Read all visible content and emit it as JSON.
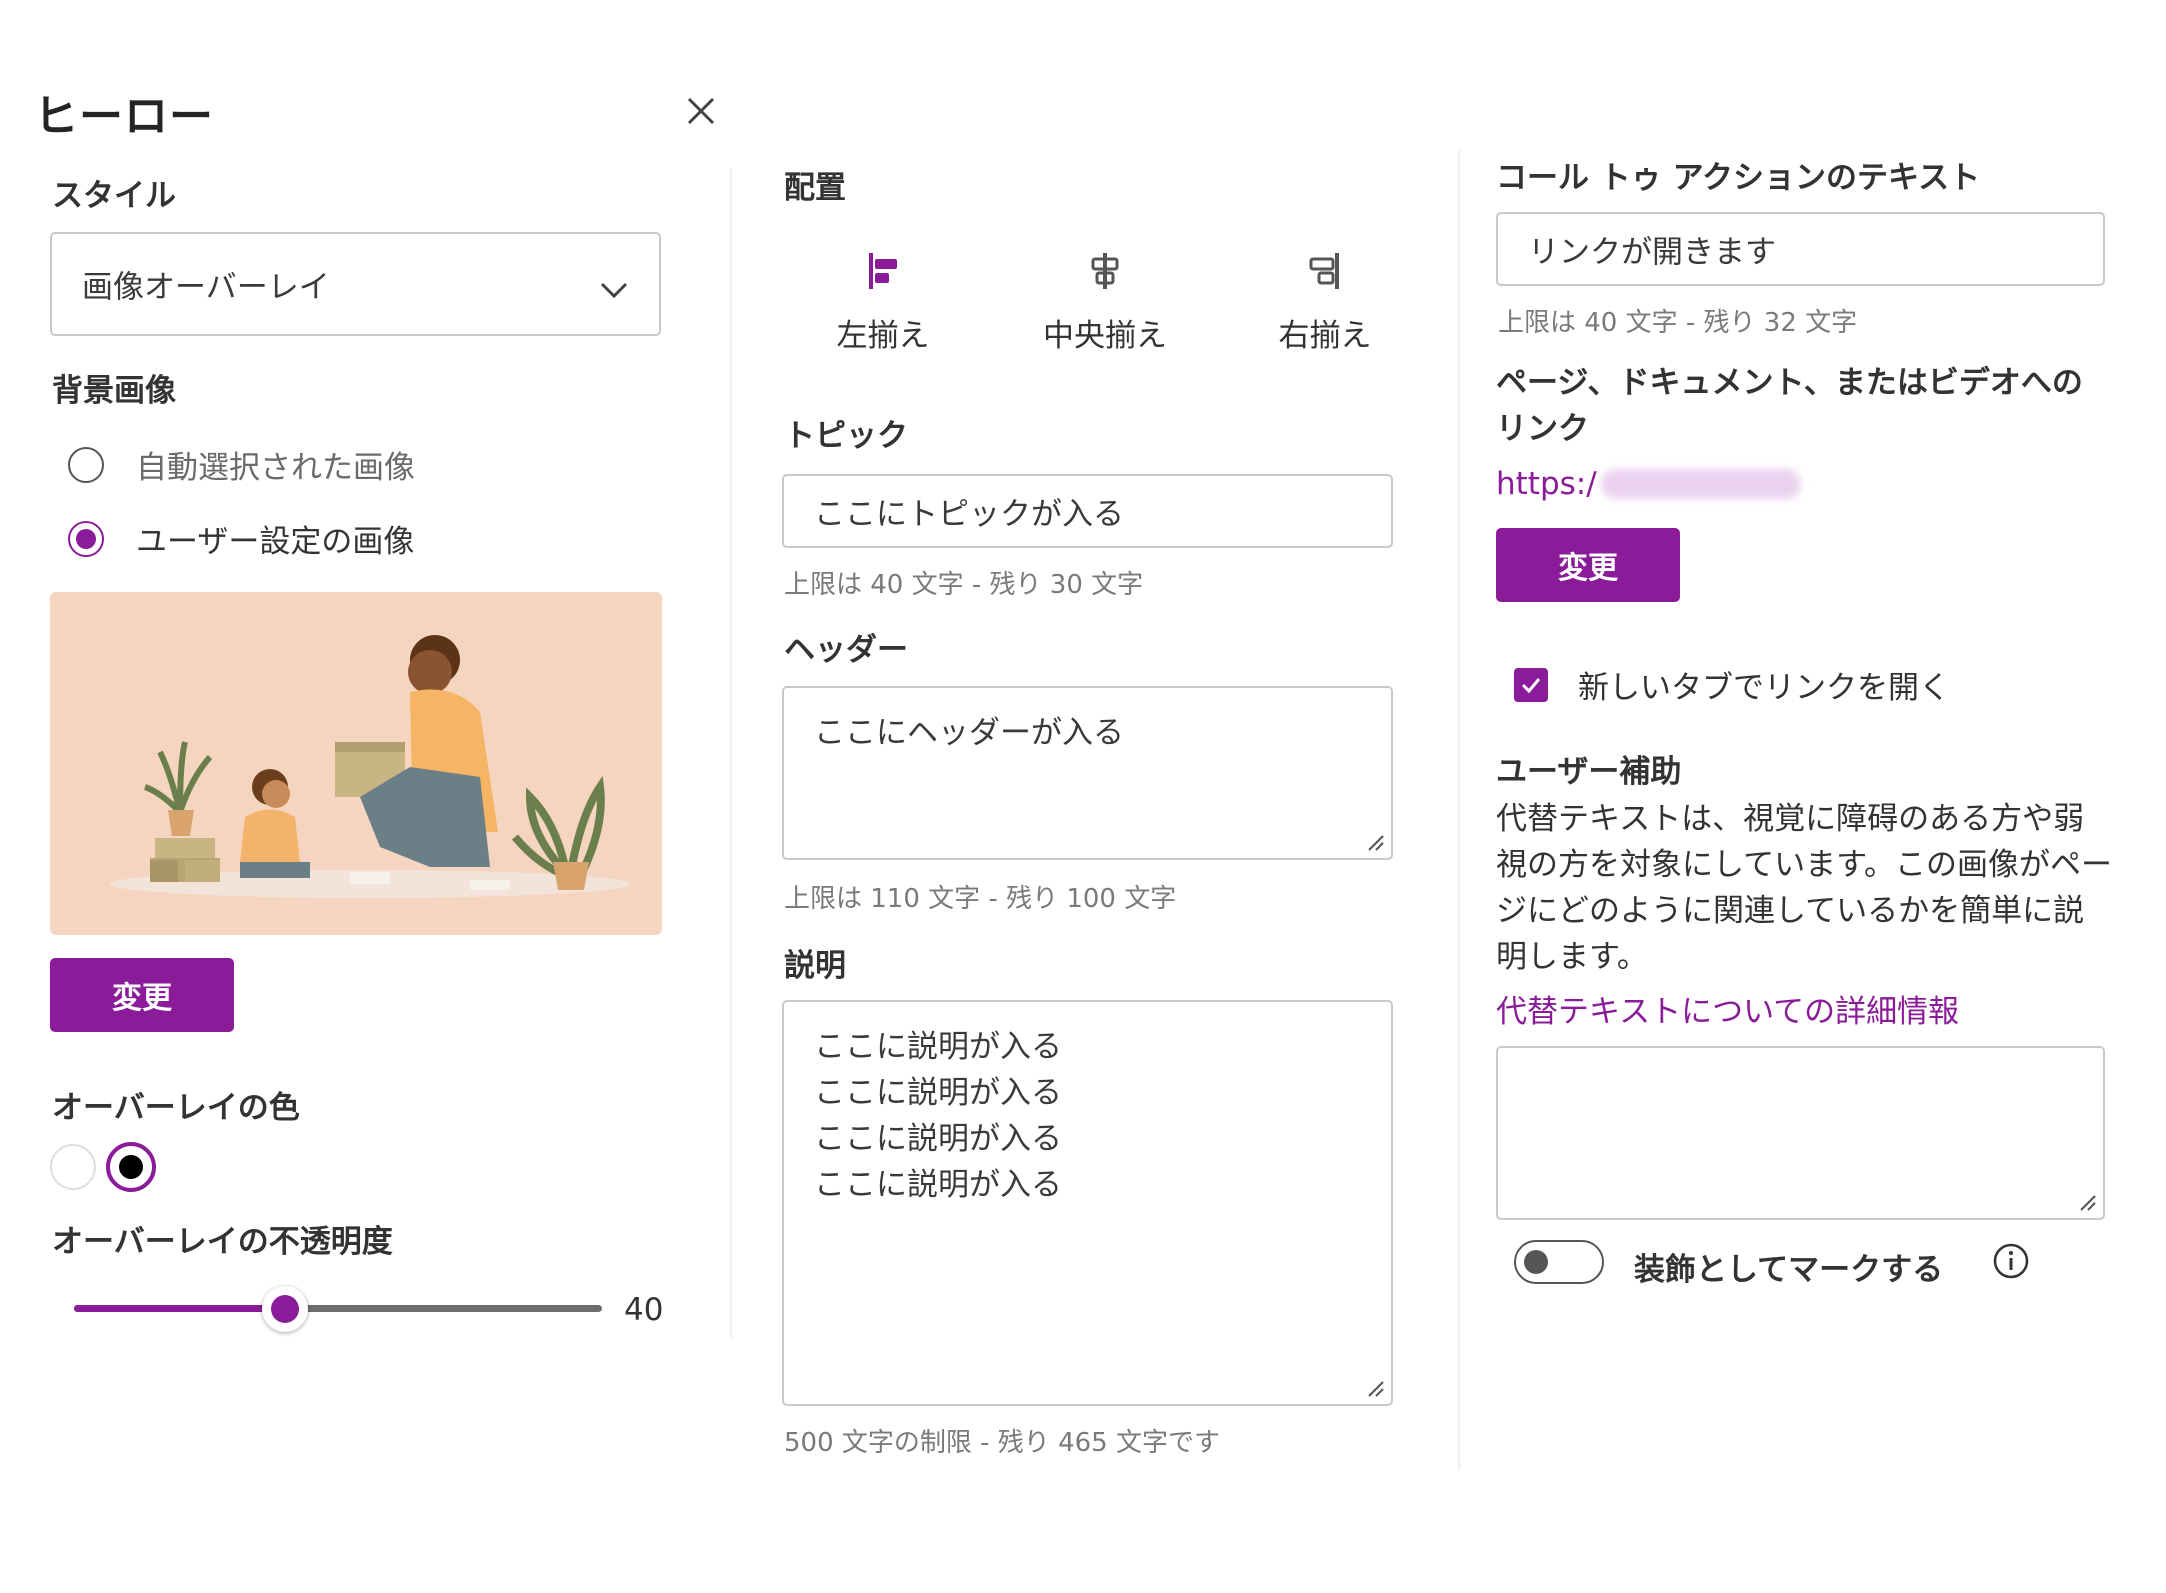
{
  "panel": {
    "title": "ヒーロー",
    "close_label": "close"
  },
  "left": {
    "style_label": "スタイル",
    "style_value": "画像オーバーレイ",
    "background_label": "背景画像",
    "background_options": [
      {
        "label": "自動選択された画像",
        "selected": false
      },
      {
        "label": "ユーザー設定の画像",
        "selected": true
      }
    ],
    "change_button": "変更",
    "overlay_color_label": "オーバーレイの色",
    "overlay_colors": [
      {
        "color": "#ffffff",
        "selected": false
      },
      {
        "color": "#000000",
        "selected": true
      }
    ],
    "opacity_label": "オーバーレイの不透明度",
    "opacity_value": "40",
    "opacity_fraction": 0.4
  },
  "middle": {
    "alignment_label": "配置",
    "alignment_options": [
      {
        "label": "左揃え",
        "icon": "align-left-icon",
        "selected": true
      },
      {
        "label": "中央揃え",
        "icon": "align-center-icon",
        "selected": false
      },
      {
        "label": "右揃え",
        "icon": "align-right-icon",
        "selected": false
      }
    ],
    "topic_label": "トピック",
    "topic_value": "ここにトピックが入る",
    "topic_hint": "上限は 40 文字 - 残り 30 文字",
    "header_label": "ヘッダー",
    "header_value": "ここにヘッダーが入る",
    "header_hint": "上限は 110 文字 - 残り 100 文字",
    "description_label": "説明",
    "description_value": "ここに説明が入る\nここに説明が入る\nここに説明が入る\nここに説明が入る",
    "description_hint": "500 文字の制限 - 残り 465 文字です"
  },
  "right": {
    "cta_label": "コール トゥ アクションのテキスト",
    "cta_value": "リンクが開きます",
    "cta_hint": "上限は 40 文字 - 残り 32 文字",
    "link_label": "ページ、ドキュメント、またはビデオへのリンク",
    "link_value": "https:/",
    "change_button": "変更",
    "new_tab_label": "新しいタブでリンクを開く",
    "new_tab_checked": true,
    "a11y_label": "ユーザー補助",
    "a11y_description": "代替テキストは、視覚に障碍のある方や弱視の方を対象にしています。この画像がページにどのように関連しているかを簡単に説明します。",
    "a11y_link": "代替テキストについての詳細情報",
    "alt_text_value": "",
    "decorative_label": "装飾としてマークする",
    "decorative_on": false
  },
  "colors": {
    "accent": "#8a1c9a",
    "image_bg": "#f6d5c0"
  }
}
